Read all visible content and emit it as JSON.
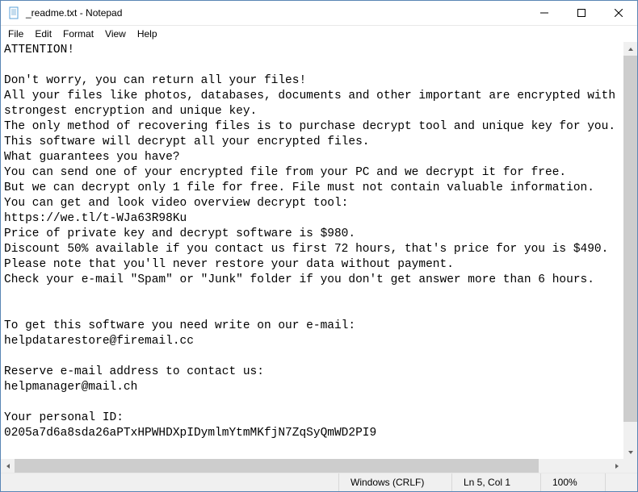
{
  "titlebar": {
    "title": "_readme.txt - Notepad"
  },
  "menu": {
    "file": "File",
    "edit": "Edit",
    "format": "Format",
    "view": "View",
    "help": "Help"
  },
  "document": {
    "lines": [
      "ATTENTION!",
      "",
      "Don't worry, you can return all your files!",
      "All your files like photos, databases, documents and other important are encrypted with",
      "strongest encryption and unique key.",
      "The only method of recovering files is to purchase decrypt tool and unique key for you.",
      "This software will decrypt all your encrypted files.",
      "What guarantees you have?",
      "You can send one of your encrypted file from your PC and we decrypt it for free.",
      "But we can decrypt only 1 file for free. File must not contain valuable information.",
      "You can get and look video overview decrypt tool:",
      "https://we.tl/t-WJa63R98Ku",
      "Price of private key and decrypt software is $980.",
      "Discount 50% available if you contact us first 72 hours, that's price for you is $490.",
      "Please note that you'll never restore your data without payment.",
      "Check your e-mail \"Spam\" or \"Junk\" folder if you don't get answer more than 6 hours.",
      "",
      "",
      "To get this software you need write on our e-mail:",
      "helpdatarestore@firemail.cc",
      "",
      "Reserve e-mail address to contact us:",
      "helpmanager@mail.ch",
      "",
      "Your personal ID:",
      "0205a7d6a8sda26aPTxHPWHDXpIDymlmYtmMKfjN7ZqSyQmWD2PI9"
    ]
  },
  "statusbar": {
    "encoding": "Windows (CRLF)",
    "position": "Ln 5, Col 1",
    "zoom": "100%"
  }
}
